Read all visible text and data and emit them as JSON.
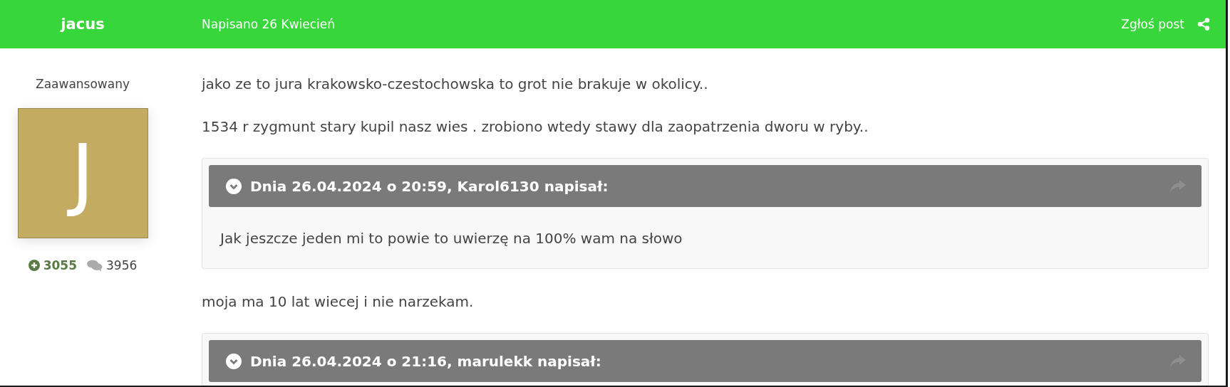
{
  "post_header": {
    "author": "jacus",
    "date": "Napisano 26 Kwiecień",
    "report": "Zgłoś post"
  },
  "author_panel": {
    "rank": "Zaawansowany",
    "avatar_letter": "J",
    "reputation": "3055",
    "posts": "3956"
  },
  "content": [
    {
      "kind": "paragraph",
      "text": "jako ze to jura krakowsko-czestochowska to grot nie brakuje w okolicy.."
    },
    {
      "kind": "paragraph",
      "text": "1534 r zygmunt stary kupil nasz wies . zrobiono wtedy stawy dla zaopatrzenia dworu w ryby.."
    },
    {
      "kind": "quote",
      "header": "Dnia 26.04.2024 o 20:59, Karol6130 napisał:",
      "body": "Jak jeszcze jeden mi to powie to uwierzę na 100% wam na słowo"
    },
    {
      "kind": "paragraph",
      "text": "moja ma 10 lat wiecej i nie narzekam."
    },
    {
      "kind": "quote",
      "header": "Dnia 26.04.2024 o 21:16, marulekk napisał:"
    }
  ]
}
